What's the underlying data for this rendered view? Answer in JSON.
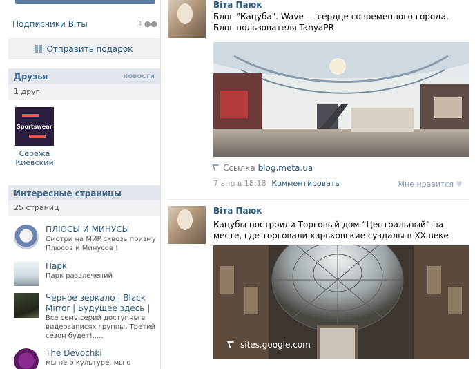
{
  "sidebar": {
    "subscribers_label": "Подписчики Віты",
    "subscribers_count": "3",
    "gift_button": "Отправить подарок",
    "friends": {
      "title": "Друзья",
      "news_link": "новости",
      "count_label": "1 друг",
      "items": [
        {
          "name_line1": "Серёжа",
          "name_line2": "Киевский",
          "photo_text": "Sportswear"
        }
      ]
    },
    "pages": {
      "title": "Интересные страницы",
      "count_label": "25 страниц",
      "items": [
        {
          "title": "ПЛЮСЫ И МИНУСЫ",
          "desc": "Смотри на МИР сквозь призму Плюсов и Минусов !"
        },
        {
          "title": "Парк",
          "desc": "Парк развлечений"
        },
        {
          "title": "Черное зеркало | Black Mirror | Будущее здесь |",
          "desc": "Все семь серий доступны в видеозаписях группы. Третий сезон будет!....."
        },
        {
          "title": "The Devochki",
          "desc": "мы не о культуре, мы о"
        }
      ]
    }
  },
  "feed": {
    "posts": [
      {
        "author": "Віта Паюк",
        "text": "Блог \"Кацуба\". Wave — сердце современного города, Блог пользователя TanyaPR",
        "link_prefix": "Ссылка",
        "link_domain": "blog.meta.ua",
        "date": "7 апр в 18:18",
        "comment": "Комментировать",
        "like": "Мне нравится"
      },
      {
        "author": "Віта Паюк",
        "text": "Кацубы построили Торговый дом “Центральный” на месте, где торговали харьковские суздалы в XX веке",
        "image_caption": "sites.google.com"
      }
    ]
  },
  "colors": {
    "link": "#2b587a",
    "header_bg": "#e1e7ed",
    "accent": "#597da3"
  }
}
